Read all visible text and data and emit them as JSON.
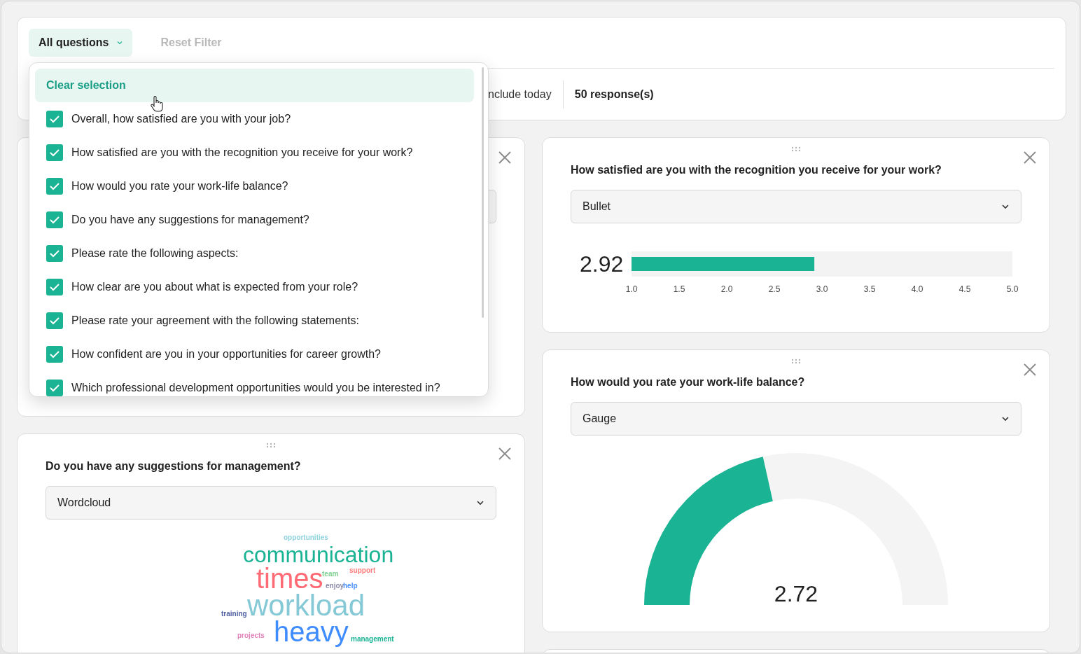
{
  "filter": {
    "dropdown_label": "All questions",
    "reset": "Reset Filter",
    "include_today": "nclude today",
    "responses": "50 response(s)"
  },
  "question_menu": {
    "clear": "Clear selection",
    "items": [
      {
        "label": "Overall, how satisfied are you with your job?",
        "checked": true
      },
      {
        "label": "How satisfied are you with the recognition you receive for your work?",
        "checked": true
      },
      {
        "label": "How would you rate your work-life balance?",
        "checked": true
      },
      {
        "label": "Do you have any suggestions for management?",
        "checked": true
      },
      {
        "label": "Please rate the following aspects:",
        "checked": true
      },
      {
        "label": "How clear are you about what is expected from your role?",
        "checked": true
      },
      {
        "label": "Please rate your agreement with the following statements:",
        "checked": true
      },
      {
        "label": "How confident are you in your opportunities for career growth?",
        "checked": true
      },
      {
        "label": "Which professional development opportunities would you be interested in?",
        "checked": true
      }
    ]
  },
  "left_cards": [
    {
      "kind": "covered"
    },
    {
      "kind": "wordcloud",
      "title": "Do you have any suggestions for management?",
      "visualizer": "Wordcloud",
      "words": [
        {
          "text": "opportunities",
          "color": "#8fd3e0"
        },
        {
          "text": "communication",
          "color": "#1ab394"
        },
        {
          "text": "times",
          "color": "#ff6b74"
        },
        {
          "text": "team",
          "color": "#7dcf8f"
        },
        {
          "text": "support",
          "color": "#ff7b7b"
        },
        {
          "text": "enjoy",
          "color": "#8a8aa8"
        },
        {
          "text": "help",
          "color": "#4a90ff"
        },
        {
          "text": "training",
          "color": "#4f5fa0"
        },
        {
          "text": "workload",
          "color": "#86c9d6"
        },
        {
          "text": "projects",
          "color": "#e083bd"
        },
        {
          "text": "heavy",
          "color": "#3f8cff"
        },
        {
          "text": "management",
          "color": "#1ab394"
        }
      ]
    }
  ],
  "right_cards": [
    {
      "kind": "bullet",
      "title": "How satisfied are you with the recognition you receive for your work?",
      "visualizer": "Bullet",
      "value": "2.92",
      "level": 0.48,
      "scale": [
        "1.0",
        "1.5",
        "2.0",
        "2.5",
        "3.0",
        "3.5",
        "4.0",
        "4.5",
        "5.0"
      ]
    },
    {
      "kind": "gauge",
      "title": "How would you rate your work-life balance?",
      "visualizer": "Gauge",
      "value": "2.72",
      "level": 0.43
    },
    {
      "kind": "blank"
    }
  ]
}
